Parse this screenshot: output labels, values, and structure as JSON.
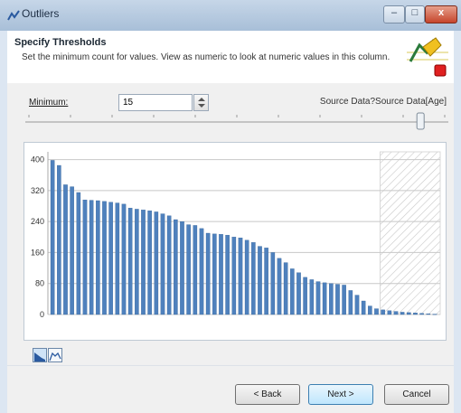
{
  "window": {
    "title": "Outliers"
  },
  "header": {
    "title": "Specify Thresholds",
    "description": "Set the minimum count for values.  View as numeric to look at numeric values in this column."
  },
  "form": {
    "minimum_label": "Minimum:",
    "minimum_value": "15",
    "source_label": "Source Data?Source Data[Age]"
  },
  "slider": {
    "value_fraction": 0.95
  },
  "buttons": {
    "back": "< Back",
    "next": "Next >",
    "cancel": "Cancel"
  },
  "window_controls": {
    "minimize": "–",
    "maximize": "□",
    "close": "x"
  },
  "colors": {
    "bar": "#4f81bd",
    "bar_edge": "#2f5f95",
    "hatch": "#c9c9c9"
  },
  "chart_data": {
    "type": "bar",
    "y_ticks": [
      "0",
      "80",
      "160",
      "240",
      "320",
      "400"
    ],
    "ylim": [
      0,
      420
    ],
    "threshold": 15,
    "values": [
      398,
      385,
      335,
      330,
      315,
      296,
      295,
      294,
      292,
      290,
      288,
      285,
      275,
      272,
      270,
      268,
      265,
      260,
      255,
      245,
      240,
      232,
      230,
      222,
      210,
      208,
      207,
      205,
      200,
      198,
      192,
      186,
      176,
      172,
      160,
      145,
      134,
      118,
      108,
      96,
      90,
      85,
      82,
      80,
      78,
      76,
      62,
      50,
      35,
      22,
      15,
      12,
      10,
      8,
      6,
      5,
      4,
      3,
      2,
      1
    ],
    "xlabel": "",
    "ylabel": "",
    "grid": true
  }
}
